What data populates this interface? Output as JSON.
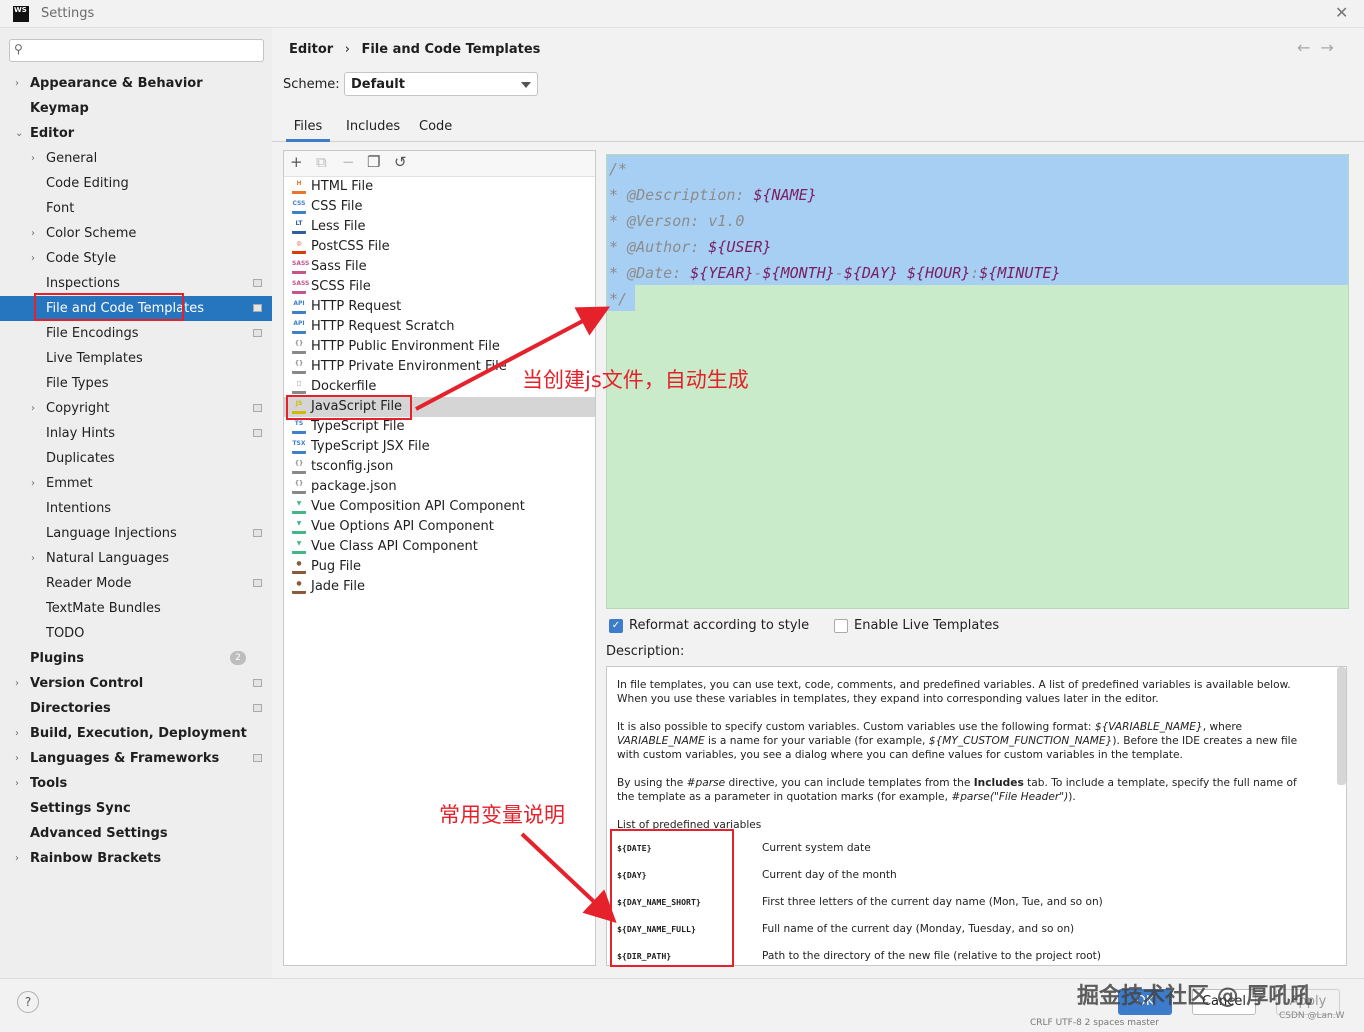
{
  "window": {
    "title": "Settings",
    "logo": "WS"
  },
  "search": {
    "placeholder": ""
  },
  "tree": [
    {
      "label": "Appearance & Behavior",
      "bold": true,
      "chevron": "right",
      "indent": 0
    },
    {
      "label": "Keymap",
      "bold": true,
      "chevron": "",
      "indent": 0
    },
    {
      "label": "Editor",
      "bold": true,
      "chevron": "down",
      "indent": 0
    },
    {
      "label": "General",
      "bold": false,
      "chevron": "right",
      "indent": 1
    },
    {
      "label": "Code Editing",
      "bold": false,
      "chevron": "",
      "indent": 1
    },
    {
      "label": "Font",
      "bold": false,
      "chevron": "",
      "indent": 1
    },
    {
      "label": "Color Scheme",
      "bold": false,
      "chevron": "right",
      "indent": 1
    },
    {
      "label": "Code Style",
      "bold": false,
      "chevron": "right",
      "indent": 1
    },
    {
      "label": "Inspections",
      "bold": false,
      "chevron": "",
      "indent": 1,
      "project": true
    },
    {
      "label": "File and Code Templates",
      "bold": false,
      "chevron": "",
      "indent": 1,
      "selected": true,
      "project": true
    },
    {
      "label": "File Encodings",
      "bold": false,
      "chevron": "",
      "indent": 1,
      "project": true
    },
    {
      "label": "Live Templates",
      "bold": false,
      "chevron": "",
      "indent": 1
    },
    {
      "label": "File Types",
      "bold": false,
      "chevron": "",
      "indent": 1
    },
    {
      "label": "Copyright",
      "bold": false,
      "chevron": "right",
      "indent": 1,
      "project": true
    },
    {
      "label": "Inlay Hints",
      "bold": false,
      "chevron": "",
      "indent": 1,
      "project": true
    },
    {
      "label": "Duplicates",
      "bold": false,
      "chevron": "",
      "indent": 1
    },
    {
      "label": "Emmet",
      "bold": false,
      "chevron": "right",
      "indent": 1
    },
    {
      "label": "Intentions",
      "bold": false,
      "chevron": "",
      "indent": 1
    },
    {
      "label": "Language Injections",
      "bold": false,
      "chevron": "",
      "indent": 1,
      "project": true
    },
    {
      "label": "Natural Languages",
      "bold": false,
      "chevron": "right",
      "indent": 1
    },
    {
      "label": "Reader Mode",
      "bold": false,
      "chevron": "",
      "indent": 1,
      "project": true
    },
    {
      "label": "TextMate Bundles",
      "bold": false,
      "chevron": "",
      "indent": 1
    },
    {
      "label": "TODO",
      "bold": false,
      "chevron": "",
      "indent": 1
    },
    {
      "label": "Plugins",
      "bold": true,
      "chevron": "",
      "indent": 0,
      "badge": "2"
    },
    {
      "label": "Version Control",
      "bold": true,
      "chevron": "right",
      "indent": 0,
      "project": true
    },
    {
      "label": "Directories",
      "bold": true,
      "chevron": "",
      "indent": 0,
      "project": true
    },
    {
      "label": "Build, Execution, Deployment",
      "bold": true,
      "chevron": "right",
      "indent": 0
    },
    {
      "label": "Languages & Frameworks",
      "bold": true,
      "chevron": "right",
      "indent": 0,
      "project": true
    },
    {
      "label": "Tools",
      "bold": true,
      "chevron": "right",
      "indent": 0
    },
    {
      "label": "Settings Sync",
      "bold": true,
      "chevron": "",
      "indent": 0
    },
    {
      "label": "Advanced Settings",
      "bold": true,
      "chevron": "",
      "indent": 0
    },
    {
      "label": "Rainbow Brackets",
      "bold": true,
      "chevron": "right",
      "indent": 0
    }
  ],
  "breadcrumb": {
    "parent": "Editor",
    "separator": "›",
    "current": "File and Code Templates"
  },
  "nav": {
    "back": "←",
    "forward": "→"
  },
  "scheme": {
    "label": "Scheme:",
    "value": "Default"
  },
  "tabs": [
    {
      "label": "Files",
      "active": true
    },
    {
      "label": "Includes"
    },
    {
      "label": "Code"
    }
  ],
  "toolbar": {
    "add": "+",
    "copy": "⧉",
    "remove": "−",
    "duplicate": "❐",
    "reset": "↺"
  },
  "files": [
    {
      "name": "HTML File",
      "icon": "html",
      "badge": "H",
      "color": "#e8742d"
    },
    {
      "name": "CSS File",
      "icon": "css",
      "badge": "CSS",
      "color": "#3e7fc9"
    },
    {
      "name": "Less File",
      "icon": "less",
      "badge": "LT",
      "color": "#2d5ea0"
    },
    {
      "name": "PostCSS File",
      "icon": "postcss",
      "badge": "◎",
      "color": "#dd3a0a"
    },
    {
      "name": "Sass File",
      "icon": "sass",
      "badge": "SASS",
      "color": "#c6538c"
    },
    {
      "name": "SCSS File",
      "icon": "scss",
      "badge": "SASS",
      "color": "#c6538c"
    },
    {
      "name": "HTTP Request",
      "icon": "http",
      "badge": "API",
      "color": "#3e7fc9"
    },
    {
      "name": "HTTP Request Scratch",
      "icon": "http",
      "badge": "API",
      "color": "#3e7fc9"
    },
    {
      "name": "HTTP Public Environment File",
      "icon": "http-env",
      "badge": "{}",
      "color": "#888888"
    },
    {
      "name": "HTTP Private Environment File",
      "icon": "http-env",
      "badge": "{}",
      "color": "#888888"
    },
    {
      "name": "Dockerfile",
      "icon": "docker",
      "badge": "◻",
      "color": "#888888"
    },
    {
      "name": "JavaScript File",
      "icon": "js",
      "badge": "JS",
      "color": "#d4b800",
      "selected": true
    },
    {
      "name": "TypeScript File",
      "icon": "ts",
      "badge": "TS",
      "color": "#3e7fc9"
    },
    {
      "name": "TypeScript JSX File",
      "icon": "tsx",
      "badge": "TSX",
      "color": "#3e7fc9"
    },
    {
      "name": "tsconfig.json",
      "icon": "json",
      "badge": "{}",
      "color": "#888888"
    },
    {
      "name": "package.json",
      "icon": "json",
      "badge": "{}",
      "color": "#888888"
    },
    {
      "name": "Vue Composition API Component",
      "icon": "vue",
      "badge": "▼",
      "color": "#41b883"
    },
    {
      "name": "Vue Options API Component",
      "icon": "vue",
      "badge": "▼",
      "color": "#41b883"
    },
    {
      "name": "Vue Class API Component",
      "icon": "vue",
      "badge": "▼",
      "color": "#41b883"
    },
    {
      "name": "Pug File",
      "icon": "pug",
      "badge": "●",
      "color": "#8a5a3b"
    },
    {
      "name": "Jade File",
      "icon": "pug",
      "badge": "●",
      "color": "#8a5a3b"
    }
  ],
  "code": {
    "l1": "/*",
    "l2_prefix": "* @Description: ",
    "l2_var": "${NAME}",
    "l3": "* @Verson: v1.0",
    "l4_prefix": "* @Author: ",
    "l4_var": "${USER}",
    "l5_prefix": "* @Date: ",
    "l5_year": "${YEAR}",
    "l5_month": "${MONTH}",
    "l5_day": "${DAY}",
    "l5_hour": "${HOUR}",
    "l5_minute": "${MINUTE}",
    "dash": "-",
    "colon": ":",
    "l6": "*/"
  },
  "options": {
    "reformat": "Reformat according to style",
    "reformat_checked": true,
    "live_templates": "Enable Live Templates",
    "live_checked": false
  },
  "description": {
    "label": "Description:",
    "p1": "In file templates, you can use text, code, comments, and predefined variables. A list of predefined variables is available below. When you use these variables in templates, they expand into corresponding values later in the editor.",
    "p2a": "It is also possible to specify custom variables. Custom variables use the following format: ",
    "p2b": "${VARIABLE_NAME}",
    "p2c": ", where ",
    "p2d": "VARIABLE_NAME",
    "p2e": " is a name for your variable (for example, ",
    "p2f": "${MY_CUSTOM_FUNCTION_NAME}",
    "p2g": "). Before the IDE creates a new file with custom variables, you see a dialog where you can define values for custom variables in the template.",
    "p3a": "By using the ",
    "p3b": "#parse",
    "p3c": " directive, you can include templates from the ",
    "p3d": "Includes",
    "p3e": " tab. To include a template, specify the full name of the template as a parameter in quotation marks (for example, ",
    "p3f": "#parse(\"File Header\")",
    "p3g": ").",
    "list_title": "List of predefined variables",
    "vars": [
      {
        "name": "${DATE}",
        "desc": "Current system date"
      },
      {
        "name": "${DAY}",
        "desc": "Current day of the month"
      },
      {
        "name": "${DAY_NAME_SHORT}",
        "desc": "First three letters of the current day name (Mon, Tue, and so on)"
      },
      {
        "name": "${DAY_NAME_FULL}",
        "desc": "Full name of the current day (Monday, Tuesday, and so on)"
      },
      {
        "name": "${DIR_PATH}",
        "desc": "Path to the directory of the new file (relative to the project root)"
      }
    ]
  },
  "footer": {
    "help": "?",
    "ok": "OK",
    "cancel": "Cancel",
    "apply": "Apply"
  },
  "annotations": {
    "note1": "当创建js文件，自动生成",
    "note2": "常用变量说明",
    "color": "#e5222c"
  },
  "overlay": {
    "watermark": "掘金技术社区 @ 厚吼吼",
    "csdn": "CSDN @Lan.W",
    "status": "CRLF   UTF-8   2 spaces   master"
  }
}
